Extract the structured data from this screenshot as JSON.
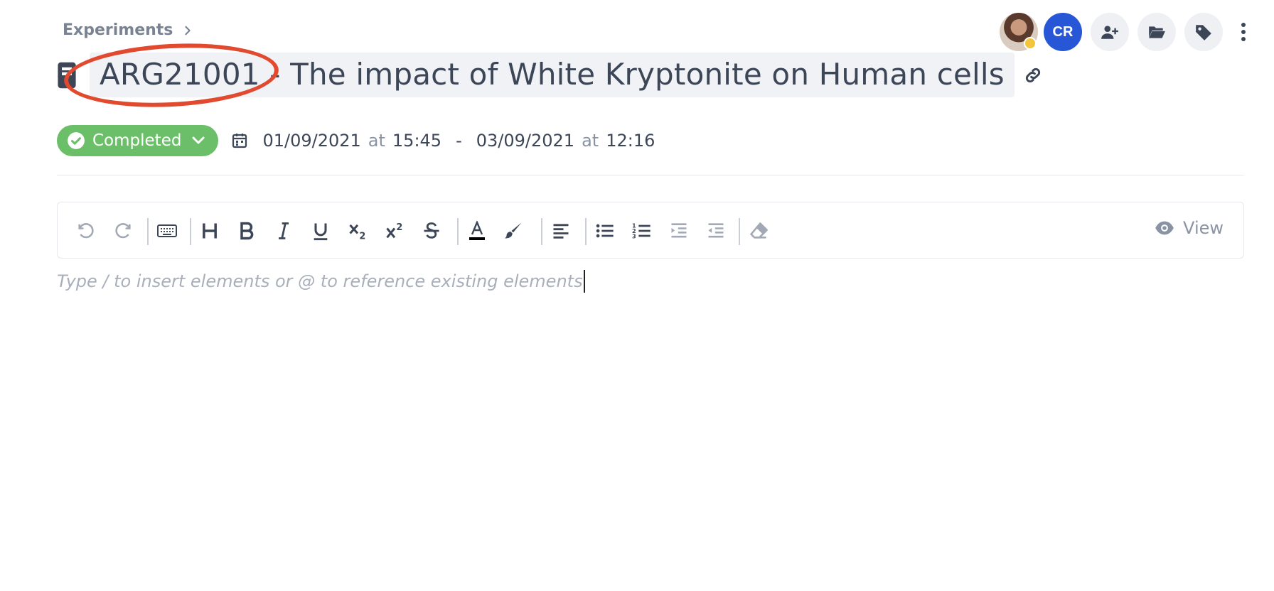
{
  "breadcrumb": {
    "label": "Experiments"
  },
  "header": {
    "title": "ARG21001 - The impact of White Kryptonite on Human cells",
    "avatar_initials": "CR"
  },
  "status": {
    "label": "Completed",
    "color": "#6cbf69"
  },
  "dates": {
    "start_date": "01/09/2021",
    "start_time": "15:45",
    "end_date": "03/09/2021",
    "end_time": "12:16",
    "at_word": "at",
    "separator": "-"
  },
  "toolbar": {
    "buttons": [
      "undo-icon",
      "redo-icon",
      "keyboard-icon",
      "heading-icon",
      "bold-icon",
      "italic-icon",
      "underline-icon",
      "subscript-icon",
      "superscript-icon",
      "strikethrough-icon",
      "text-color-icon",
      "highlight-brush-icon",
      "align-left-icon",
      "bulleted-list-icon",
      "numbered-list-icon",
      "indent-icon",
      "outdent-icon",
      "clear-format-eraser-icon"
    ],
    "view_label": "View"
  },
  "editor": {
    "placeholder": "Type / to insert elements or @ to reference existing elements"
  },
  "colors": {
    "accent_blue": "#2756d6",
    "annotation_red": "#e24a2f",
    "text": "#3c4657"
  }
}
